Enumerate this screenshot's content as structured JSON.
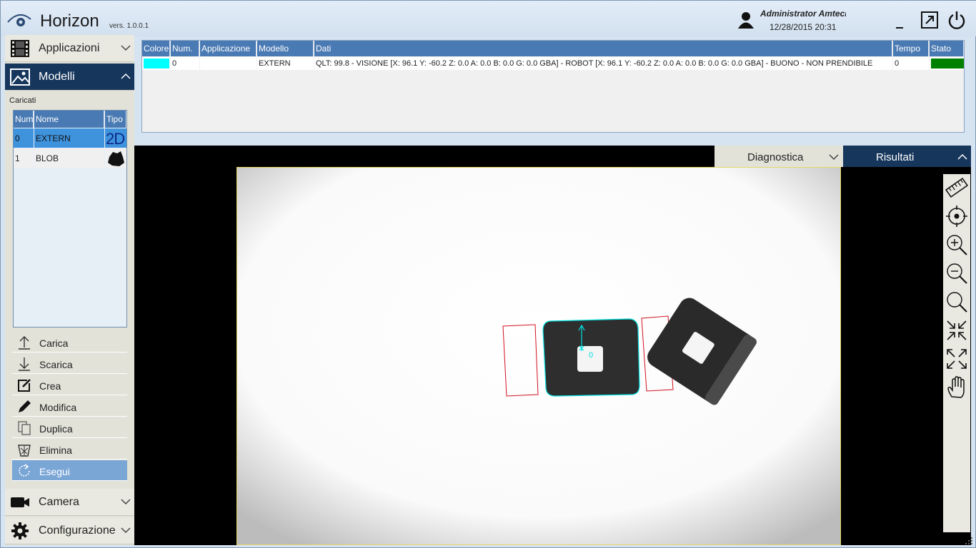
{
  "header": {
    "title": "Horizon",
    "version": "vers. 1.0.0.1",
    "user": "Administrator Amteci",
    "datetime": "12/28/2015 20:31"
  },
  "sidebar": {
    "sections": [
      {
        "label": "Applicazioni",
        "icon": "film-icon"
      },
      {
        "label": "Modelli",
        "icon": "image-icon"
      },
      {
        "label": "Camera",
        "icon": "camera-icon"
      },
      {
        "label": "Configurazione",
        "icon": "gear-icon"
      }
    ],
    "loaded_label": "Caricati",
    "models_table": {
      "columns": [
        "Num",
        "Nome",
        "Tipo"
      ],
      "rows": [
        {
          "num": "0",
          "name": "EXTERN",
          "type": "2D"
        },
        {
          "num": "1",
          "name": "BLOB",
          "type": "blob-icon"
        }
      ]
    },
    "actions": [
      {
        "label": "Carica",
        "icon": "upload-icon"
      },
      {
        "label": "Scarica",
        "icon": "download-icon"
      },
      {
        "label": "Crea",
        "icon": "edit-icon"
      },
      {
        "label": "Modifica",
        "icon": "pencil-icon"
      },
      {
        "label": "Duplica",
        "icon": "copy-icon"
      },
      {
        "label": "Elimina",
        "icon": "trash-icon"
      },
      {
        "label": "Esegui",
        "icon": "refresh-icon"
      }
    ]
  },
  "results_table": {
    "columns": [
      "Colore",
      "Num.",
      "Applicazione",
      "Modello",
      "Dati",
      "Tempo",
      "Stato"
    ],
    "rows": [
      {
        "color": "#00ffff",
        "num": "0",
        "application": "",
        "model": "EXTERN",
        "data": "QLT: 99.8 - VISIONE [X: 96.1 Y: -60.2 Z: 0.0 A: 0.0 B: 0.0 G: 0.0 GBA] - ROBOT [X: 96.1 Y: -60.2 Z: 0.0 A: 0.0 B: 0.0 G: 0.0 GBA] - BUONO -  NON PRENDIBILE",
        "time": "0",
        "status_color": "#008000"
      }
    ]
  },
  "tabs": {
    "diagnostics": "Diagnostica",
    "results": "Risultati"
  },
  "overlay": {
    "marker_label": "0"
  },
  "toolbar": [
    "ruler-icon",
    "target-icon",
    "zoom-in-icon",
    "zoom-out-icon",
    "zoom-fit-icon",
    "collapse-icon",
    "expand-icon",
    "pan-hand-icon"
  ],
  "colors": {
    "accent_dark": "#16365c",
    "header_blue": "#4a7ab3",
    "selection": "#3f93dd",
    "roi_red": "#d01020",
    "match_cyan": "#00e0e0"
  }
}
